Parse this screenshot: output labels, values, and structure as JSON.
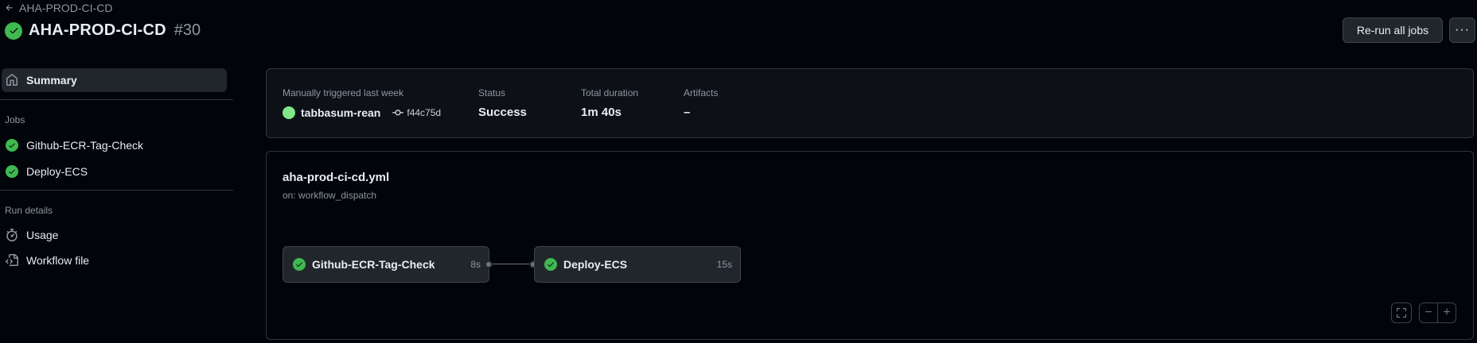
{
  "header": {
    "back_label": "AHA-PROD-CI-CD",
    "title": "AHA-PROD-CI-CD",
    "run_number": "#30",
    "rerun_label": "Re-run all jobs",
    "more_label": "···"
  },
  "sidebar": {
    "summary_label": "Summary",
    "jobs_heading": "Jobs",
    "jobs": [
      {
        "label": "Github-ECR-Tag-Check"
      },
      {
        "label": "Deploy-ECS"
      }
    ],
    "run_details_heading": "Run details",
    "usage_label": "Usage",
    "workflow_file_label": "Workflow file"
  },
  "summary": {
    "trigger_label": "Manually triggered last week",
    "actor": "tabbasum-rean",
    "commit": "f44c75d",
    "status_label": "Status",
    "status_value": "Success",
    "duration_label": "Total duration",
    "duration_value": "1m 40s",
    "artifacts_label": "Artifacts",
    "artifacts_value": "–"
  },
  "workflow": {
    "file": "aha-prod-ci-cd.yml",
    "trigger": "on: workflow_dispatch",
    "jobs": [
      {
        "name": "Github-ECR-Tag-Check",
        "duration": "8s"
      },
      {
        "name": "Deploy-ECS",
        "duration": "15s"
      }
    ],
    "zoom_out_label": "−",
    "zoom_in_label": "+"
  },
  "colors": {
    "success": "#3fb950",
    "background": "#010409",
    "panel": "#0d1117"
  }
}
